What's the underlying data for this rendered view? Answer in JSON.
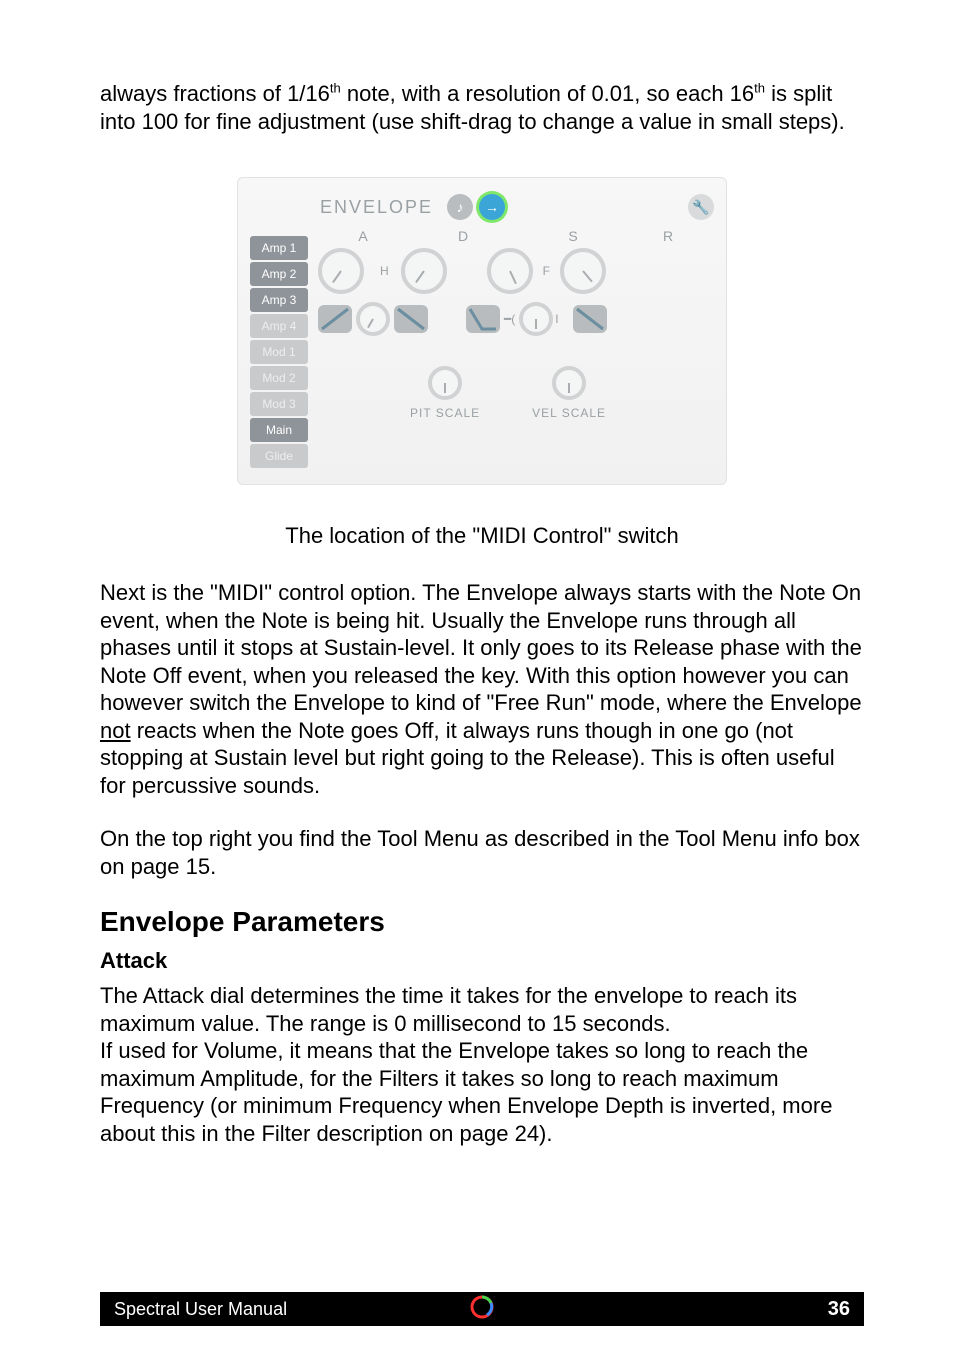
{
  "intro": {
    "t1": "always fractions of 1/16",
    "sup1": "th",
    "t2": " note, with a resolution of 0.01, so each 16",
    "sup2": "th",
    "t3": " is split into 100 for fine adjustment (use shift-drag to change a value in small steps)."
  },
  "envelope": {
    "title": "ENVELOPE",
    "icons": {
      "note": "♪",
      "arrow": "→",
      "wrench": "🔧"
    },
    "tabs": [
      "Amp 1",
      "Amp 2",
      "Amp 3",
      "Amp 4",
      "Mod 1",
      "Mod 2",
      "Mod 3",
      "Main",
      "Glide"
    ],
    "tab_states": [
      "active",
      "active",
      "active",
      "dim",
      "dim",
      "dim",
      "dim",
      "active",
      "dim"
    ],
    "adsr": {
      "A": "A",
      "D": "D",
      "S": "S",
      "R": "R",
      "H": "H",
      "F": "F",
      "I": "I"
    },
    "bottom": {
      "pit": "PIT SCALE",
      "vel": "VEL SCALE"
    }
  },
  "caption": "The location of the \"MIDI Control\" switch",
  "para1": {
    "a": "Next is the \"MIDI\" control option. The Envelope always starts with the Note On event, when the Note is being hit. Usually the Envelope runs through all phases until it stops at Sustain-level. It only goes to its Release phase with the Note Off event, when you released the key. With this option however you can however switch the Envelope to kind of \"Free Run\" mode, where the Envelope ",
    "u": "not",
    "b": " reacts when the Note goes Off, it always runs though in one go (not stopping at Sustain level but right going to the Release). This is often useful for percussive sounds."
  },
  "para2": "On the top right you find the Tool Menu as described in the Tool Menu info box on page 15.",
  "h2": "Envelope Parameters",
  "h3": "Attack",
  "para3": "The Attack dial determines the time it takes for the envelope to reach its maximum value. The range is 0 millisecond to 15 seconds.\nIf used for Volume, it means that the Envelope takes so long to reach the maximum Amplitude, for the Filters it takes so long to reach maximum Frequency (or minimum Frequency when Envelope Depth is inverted, more about this in the Filter description on page 24).",
  "footer": {
    "title": "Spectral User Manual",
    "page": "36"
  }
}
